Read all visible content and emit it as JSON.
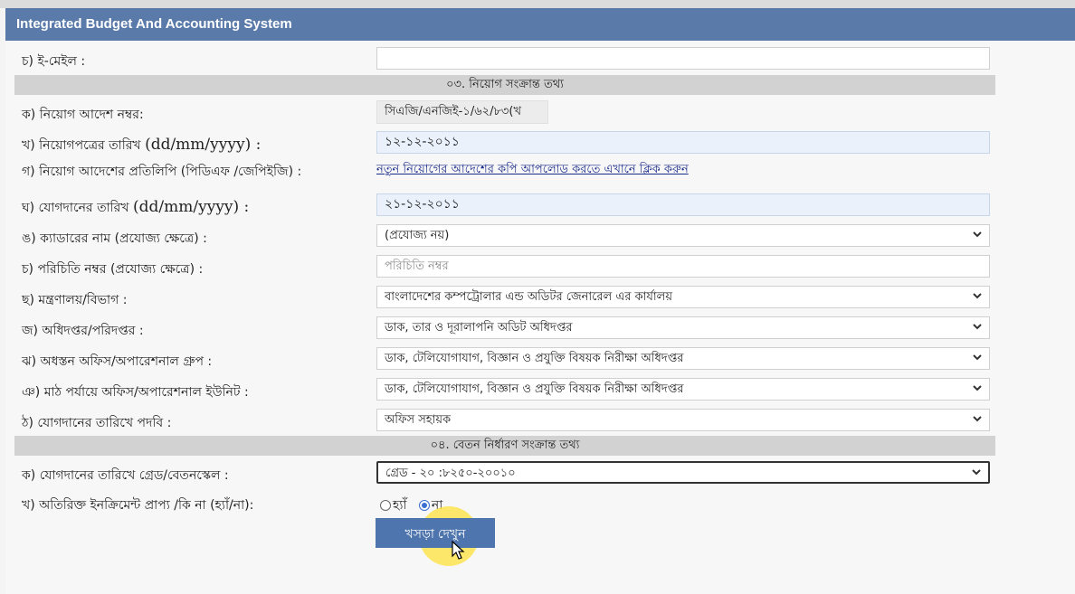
{
  "app": {
    "title": "Integrated Budget And Accounting System"
  },
  "email": {
    "label": "চ) ই-মেইল :",
    "value": ""
  },
  "sections": {
    "appointment": "০৩. নিয়োগ সংক্রান্ত তথ্য",
    "salary": "০৪. বেতন নির্ধারণ সংক্রান্ত তথ্য"
  },
  "appointment": {
    "order_no": {
      "label": "ক) নিয়োগ আদেশ নম্বর:",
      "value": "সিএজি/এনজিই-১/৬২/৮৩(খ"
    },
    "letter_date": {
      "label": "খ) নিয়োগপত্রের তারিখ",
      "format": "(dd/mm/yyyy) :",
      "value": "১২-১২-২০১১"
    },
    "order_copy": {
      "label": "গ) নিয়োগ আদেশের প্রতিলিপি (পিডিএফ /জেপিইজি) :",
      "link": "নতুন নিয়োগের আদেশের কপি আপলোড করতে এখানে ক্লিক করুন"
    },
    "join_date": {
      "label": "ঘ) যোগদানের তারিখ",
      "format": "(dd/mm/yyyy) :",
      "value": "২১-১২-২০১১"
    },
    "cadre": {
      "label": "ঙ) ক্যাডারের নাম (প্রযোজ্য ক্ষেত্রে) :",
      "value": "(প্রযোজ্য নয়)"
    },
    "id_no": {
      "label": "চ) পরিচিতি নম্বর (প্রযোজ্য ক্ষেত্রে) :",
      "placeholder": "পরিচিতি নম্বর"
    },
    "ministry": {
      "label": "ছ) মন্ত্রণালয়/বিভাগ :",
      "value": "বাংলাদেশের কম্পট্রোলার এন্ড অডিটর জেনারেল এর কার্যালয়"
    },
    "directorate": {
      "label": "জ) অধিদপ্তর/পরিদপ্তর :",
      "value": "ডাক, তার ও দূরালাপনি অডিট অধিদপ্তর"
    },
    "sub_office": {
      "label": "ঝ) অধস্তন অফিস/অপারেশনাল গ্রুপ :",
      "value": "ডাক, টেলিযোগাযাগ, বিজ্ঞান ও প্রযুক্তি বিষয়ক নিরীক্ষা অধিদপ্তর"
    },
    "field_office": {
      "label": "ঞ) মাঠ পর্যায়ে অফিস/অপারেশনাল ইউনিট :",
      "value": "ডাক, টেলিযোগাযাগ, বিজ্ঞান ও প্রযুক্তি বিষয়ক নিরীক্ষা অধিদপ্তর"
    },
    "designation": {
      "label": "ঠ) যোগদানের তারিখে পদবি :",
      "value": "অফিস সহায়ক"
    }
  },
  "salary": {
    "grade": {
      "label": "ক) যোগদানের তারিখে গ্রেড/বেতনস্কেল :",
      "value": "গ্রেড - ২০ :৮২৫০-২০০১০"
    },
    "increment": {
      "label": "খ) অতিরিক্ত ইনক্রিমেন্ট প্রাপ্য /কি না (হ্যাঁ/না):",
      "yes": "হ্যাঁ",
      "no": "না",
      "selected": "no"
    }
  },
  "actions": {
    "draft_button": "খসড়া দেখুন"
  },
  "icons": {
    "dropdown": "chevron-down-icon",
    "cursor": "mouse-pointer-icon"
  },
  "colors": {
    "header": "#5a7baa",
    "button": "#4e75ad",
    "highlight": "#ffe23c"
  }
}
